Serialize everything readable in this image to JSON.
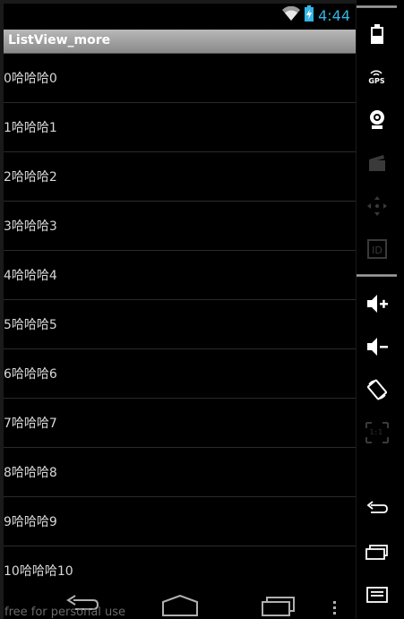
{
  "status_bar": {
    "time": "4:44",
    "wifi_icon": "wifi-icon",
    "battery_icon": "battery-charging-icon"
  },
  "action_bar": {
    "title": "ListView_more"
  },
  "list": {
    "items": [
      {
        "label": "0哈哈哈0"
      },
      {
        "label": "1哈哈哈1"
      },
      {
        "label": "2哈哈哈2"
      },
      {
        "label": "3哈哈哈3"
      },
      {
        "label": "4哈哈哈4"
      },
      {
        "label": "5哈哈哈5"
      },
      {
        "label": "6哈哈哈6"
      },
      {
        "label": "7哈哈哈7"
      },
      {
        "label": "8哈哈哈8"
      },
      {
        "label": "9哈哈哈9"
      },
      {
        "label": "10哈哈哈10"
      }
    ]
  },
  "nav_bar": {
    "buttons": [
      "back-icon",
      "home-icon",
      "recent-apps-icon",
      "overflow-menu-icon"
    ]
  },
  "watermark": "free for personal use",
  "emulator_sidebar": {
    "buttons": [
      {
        "icon": "battery-icon"
      },
      {
        "icon": "gps-icon",
        "label": "GPS"
      },
      {
        "icon": "webcam-icon"
      },
      {
        "icon": "video-capture-icon"
      },
      {
        "icon": "dpad-icon"
      },
      {
        "icon": "id-icon",
        "label": "ID"
      },
      {
        "icon": "volume-up-icon"
      },
      {
        "icon": "volume-down-icon"
      },
      {
        "icon": "rotate-icon"
      },
      {
        "icon": "scale-icon",
        "label": "1:1"
      },
      {
        "icon": "back-icon"
      },
      {
        "icon": "recent-apps-icon"
      },
      {
        "icon": "menu-icon"
      }
    ]
  },
  "colors": {
    "clock": "#33b5e5",
    "background": "#000000",
    "action_bar": "#a0a0a0",
    "list_text": "#d8d8d8"
  }
}
